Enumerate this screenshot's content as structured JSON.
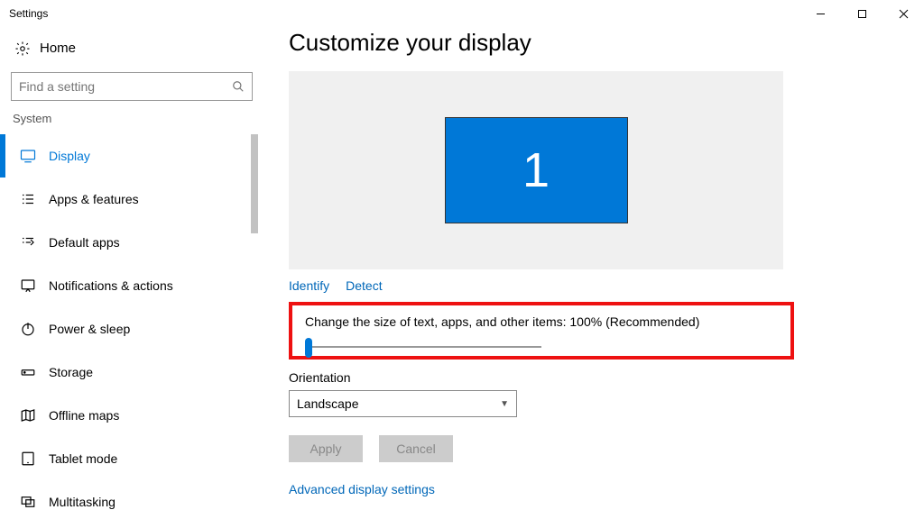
{
  "window": {
    "title": "Settings"
  },
  "sidebar": {
    "home_label": "Home",
    "search_placeholder": "Find a setting",
    "section_label": "System",
    "items": [
      {
        "label": "Display"
      },
      {
        "label": "Apps & features"
      },
      {
        "label": "Default apps"
      },
      {
        "label": "Notifications & actions"
      },
      {
        "label": "Power & sleep"
      },
      {
        "label": "Storage"
      },
      {
        "label": "Offline maps"
      },
      {
        "label": "Tablet mode"
      },
      {
        "label": "Multitasking"
      }
    ]
  },
  "content": {
    "page_title": "Customize your display",
    "monitor_number": "1",
    "identify_label": "Identify",
    "detect_label": "Detect",
    "scale_label": "Change the size of text, apps, and other items: 100% (Recommended)",
    "orientation_label": "Orientation",
    "orientation_value": "Landscape",
    "apply_label": "Apply",
    "cancel_label": "Cancel",
    "advanced_link": "Advanced display settings"
  }
}
